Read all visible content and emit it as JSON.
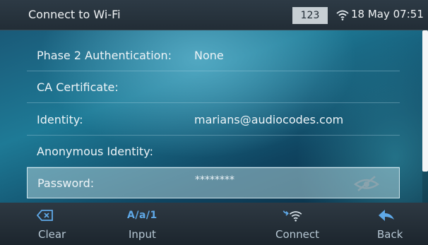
{
  "header": {
    "title": "Connect to Wi-Fi",
    "input_mode": "123",
    "datetime": "18 May 07:51"
  },
  "form": {
    "rows": [
      {
        "label": "Phase 2 Authentication:",
        "value": "None"
      },
      {
        "label": "CA Certificate:",
        "value": ""
      },
      {
        "label": "Identity:",
        "value": "marians@audiocodes.com"
      },
      {
        "label": "Anonymous Identity:",
        "value": ""
      },
      {
        "label": "Password:",
        "value": "********"
      }
    ]
  },
  "softkeys": {
    "clear": "Clear",
    "input": "Input",
    "input_glyph": "A/a/1",
    "connect": "Connect",
    "back": "Back"
  },
  "colors": {
    "accent": "#5fa9e8",
    "header_bg": "#2d3a45",
    "softkey_bg": "#1c252d",
    "selected_row": "#9ec3cf"
  },
  "icons": [
    "clear-icon",
    "input-mode-icon",
    "connect-wifi-icon",
    "back-arrow-icon",
    "wifi-status-icon",
    "hidden-password-icon"
  ]
}
